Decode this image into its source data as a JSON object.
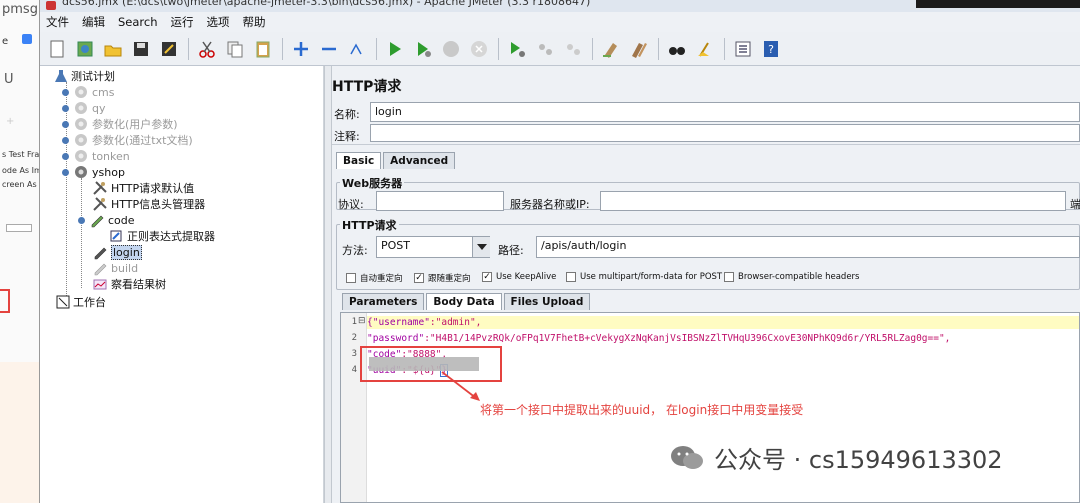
{
  "window": {
    "title": "dcs56.jmx (E:\\dcs\\two\\jmeter\\apache-jmeter-3.3\\bin\\dcs56.jmx) - Apache JMeter (3.3 r1808647)"
  },
  "background_app": {
    "fragments": [
      "pmsg",
      "e",
      "U",
      "s Test Fragn",
      "ode As Imag",
      "creen As Im"
    ]
  },
  "menu": [
    "文件",
    "编辑",
    "Search",
    "运行",
    "选项",
    "帮助"
  ],
  "toolbar": {
    "icons": [
      "new-icon",
      "templates-icon",
      "open-icon",
      "save-icon",
      "save-as-icon",
      "cut-icon",
      "copy-icon",
      "paste-icon",
      "expand-icon",
      "collapse-icon",
      "toggle-icon",
      "start-icon",
      "start-no-pause-icon",
      "stop-icon",
      "shutdown-icon",
      "remote-start-icon",
      "remote-stop-icon",
      "remote-shutdown-icon",
      "clear-icon",
      "clear-all-icon",
      "search-icon",
      "reset-search-icon",
      "function-helper-icon",
      "help-icon"
    ]
  },
  "tree": {
    "root": "测试计划",
    "items": [
      {
        "label": "cms",
        "disabled": true
      },
      {
        "label": "qy",
        "disabled": true
      },
      {
        "label": "参数化(用户参数)",
        "disabled": true
      },
      {
        "label": "参数化(通过txt文档)",
        "disabled": true
      },
      {
        "label": "tonken",
        "disabled": true
      },
      {
        "label": "yshop",
        "disabled": false
      }
    ],
    "yshop_children": [
      {
        "label": "HTTP请求默认值"
      },
      {
        "label": "HTTP信息头管理器"
      },
      {
        "label": "code"
      },
      {
        "label": "正则表达式提取器"
      },
      {
        "label": "login"
      },
      {
        "label": "build"
      },
      {
        "label": "察看结果树"
      }
    ],
    "workbench": "工作台"
  },
  "panel": {
    "title": "HTTP请求",
    "name_label": "名称:",
    "name_value": "login",
    "comment_label": "注释:",
    "tabs": [
      "Basic",
      "Advanced"
    ],
    "web_server_group": "Web服务器",
    "protocol_label": "协议:",
    "server_label": "服务器名称或IP:",
    "port_label_fragment": "端",
    "http_group": "HTTP请求",
    "method_label": "方法:",
    "method_value": "POST",
    "path_label": "路径:",
    "path_value": "/apis/auth/login",
    "checkboxes": [
      {
        "label": "自动重定向",
        "checked": false
      },
      {
        "label": "跟随重定向",
        "checked": true
      },
      {
        "label": "Use KeepAlive",
        "checked": true
      },
      {
        "label": "Use multipart/form-data for POST",
        "checked": false
      },
      {
        "label": "Browser-compatible headers",
        "checked": false
      }
    ],
    "sub_tabs": [
      "Parameters",
      "Body Data",
      "Files Upload"
    ],
    "active_sub_tab": "Body Data"
  },
  "body": {
    "line_numbers": [
      "1",
      "2",
      "3",
      "4"
    ],
    "lines": [
      {
        "fold": "⊟",
        "key": "{\"username\"",
        "value": ":\"admin\","
      },
      {
        "key": "\"password\"",
        "value": ":\"H4B1/14PvzRQk/oFPq1V7FhetB+cVekygXzNqKanjVsIBSNzZlTVHqU396CxovE30NPhKQ9d6r/YRL5RLZag0g==\","
      },
      {
        "key": "\"code\"",
        "value": ":\"8888\","
      },
      {
        "key": "\"uuid\"",
        "value": ":\"${u}\"",
        "cursor": "}"
      }
    ]
  },
  "annotation": "将第一个接口中提取出来的uuid， 在login接口中用变量接受",
  "watermark": "公众号 · cs15949613302",
  "colors": {
    "annotation_red": "#e4433f",
    "json_key": "#a000a0",
    "selection_bg": "#c4d6f0",
    "highlight_line": "#fffcc2"
  }
}
